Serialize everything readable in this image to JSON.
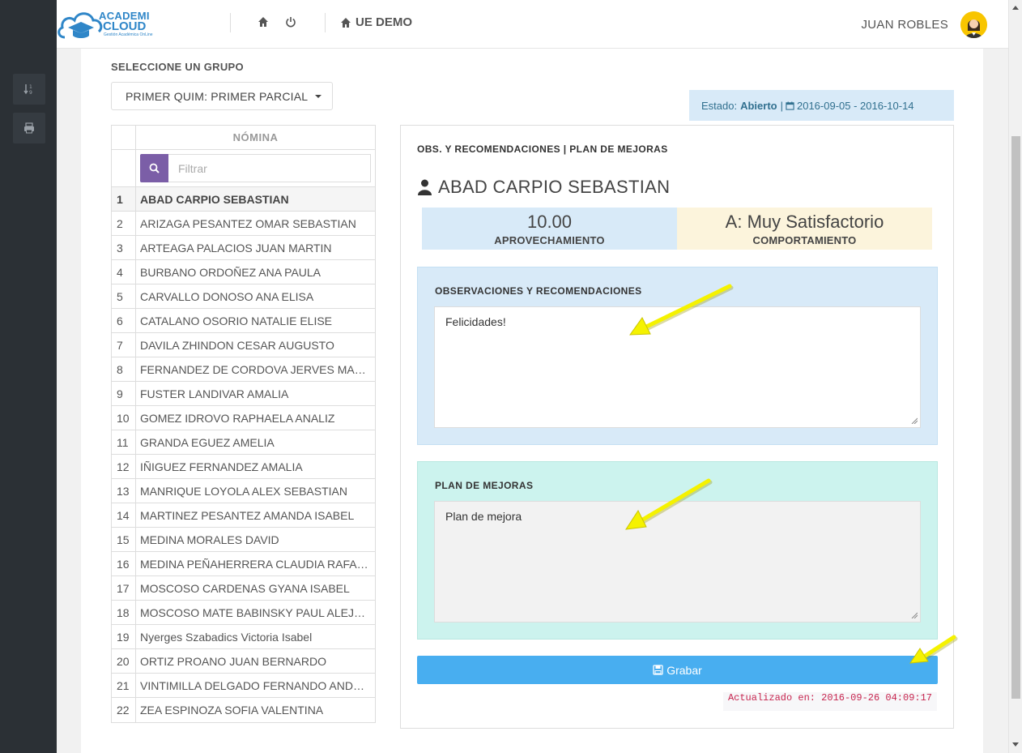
{
  "app": {
    "logo_line1": "ACADEMI",
    "logo_line2": "CLOUD",
    "logo_tagline": "Gestión Académica OnLine",
    "school_name": "UE DEMO",
    "user_name": "JUAN ROBLES"
  },
  "group": {
    "label": "SELECCIONE UN GRUPO",
    "selected": "PRIMER QUIM: PRIMER PARCIAL"
  },
  "status": {
    "prefix": "Estado:",
    "state": "Abierto",
    "separator": "|",
    "range": "2016-09-05 - 2016-10-14"
  },
  "roster": {
    "header": "NÓMINA",
    "filter_placeholder": "Filtrar",
    "rows": [
      {
        "n": "1",
        "name": "ABAD CARPIO SEBASTIAN"
      },
      {
        "n": "2",
        "name": "ARIZAGA PESANTEZ OMAR SEBASTIAN"
      },
      {
        "n": "3",
        "name": "ARTEAGA PALACIOS JUAN MARTIN"
      },
      {
        "n": "4",
        "name": "BURBANO ORDOÑEZ ANA PAULA"
      },
      {
        "n": "5",
        "name": "CARVALLO DONOSO ANA ELISA"
      },
      {
        "n": "6",
        "name": "CATALANO OSORIO NATALIE ELISE"
      },
      {
        "n": "7",
        "name": "DAVILA ZHINDON CESAR AUGUSTO"
      },
      {
        "n": "8",
        "name": "FERNANDEZ DE CORDOVA JERVES MARIA EL..."
      },
      {
        "n": "9",
        "name": "FUSTER LANDIVAR AMALIA"
      },
      {
        "n": "10",
        "name": "GOMEZ IDROVO RAPHAELA ANALIZ"
      },
      {
        "n": "11",
        "name": "GRANDA EGUEZ AMELIA"
      },
      {
        "n": "12",
        "name": "IÑIGUEZ FERNANDEZ AMALIA"
      },
      {
        "n": "13",
        "name": "MANRIQUE LOYOLA ALEX SEBASTIAN"
      },
      {
        "n": "14",
        "name": "MARTINEZ PESANTEZ AMANDA ISABEL"
      },
      {
        "n": "15",
        "name": "MEDINA MORALES DAVID"
      },
      {
        "n": "16",
        "name": "MEDINA PEÑAHERRERA CLAUDIA RAFAELA"
      },
      {
        "n": "17",
        "name": "MOSCOSO CARDENAS GYANA ISABEL"
      },
      {
        "n": "18",
        "name": "MOSCOSO MATE BABINSKY PAUL ALEJANDRO"
      },
      {
        "n": "19",
        "name": "Nyerges Szabadics Victoria Isabel"
      },
      {
        "n": "20",
        "name": "ORTIZ PROANO JUAN BERNARDO"
      },
      {
        "n": "21",
        "name": "VINTIMILLA DELGADO FERNANDO ANDRES"
      },
      {
        "n": "22",
        "name": "ZEA ESPINOZA SOFIA VALENTINA"
      }
    ]
  },
  "panel": {
    "title": "OBS. Y RECOMENDACIONES | PLAN DE MEJORAS",
    "student_name": "ABAD CARPIO SEBASTIAN",
    "grade_value": "10.00",
    "grade_label": "APROVECHAMIENTO",
    "behavior_value": "A: Muy Satisfactorio",
    "behavior_label": "COMPORTAMIENTO",
    "obs_label": "OBSERVACIONES Y RECOMENDACIONES",
    "obs_text": "Felicidades!",
    "plan_label": "PLAN DE MEJORAS",
    "plan_text": "Plan de mejora",
    "save_label": "Grabar",
    "updated": "Actualizado en: 2016-09-26 04:09:17"
  },
  "colors": {
    "accent": "#48aef0",
    "filter_button": "#7b5ea7",
    "annotation_arrow": "#f5f200"
  }
}
